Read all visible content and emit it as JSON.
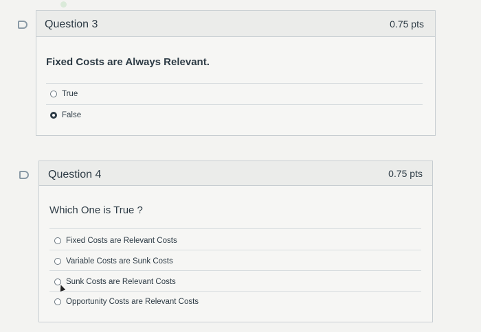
{
  "question3": {
    "title": "Question 3",
    "points": "0.75 pts",
    "prompt": "Fixed Costs are Always Relevant.",
    "options": [
      {
        "label": "True",
        "selected": false
      },
      {
        "label": "False",
        "selected": true
      }
    ]
  },
  "question4": {
    "title": "Question 4",
    "points": "0.75 pts",
    "prompt": "Which One is True ?",
    "options": [
      {
        "label": "Fixed Costs are Relevant Costs",
        "selected": false
      },
      {
        "label": "Variable Costs are Sunk Costs",
        "selected": false
      },
      {
        "label": "Sunk Costs are Relevant Costs",
        "selected": false
      },
      {
        "label": "Opportunity Costs are Relevant Costs",
        "selected": false
      }
    ]
  },
  "icons": {
    "flag": "flag-question-icon",
    "cursor": "mouse-cursor-icon"
  }
}
